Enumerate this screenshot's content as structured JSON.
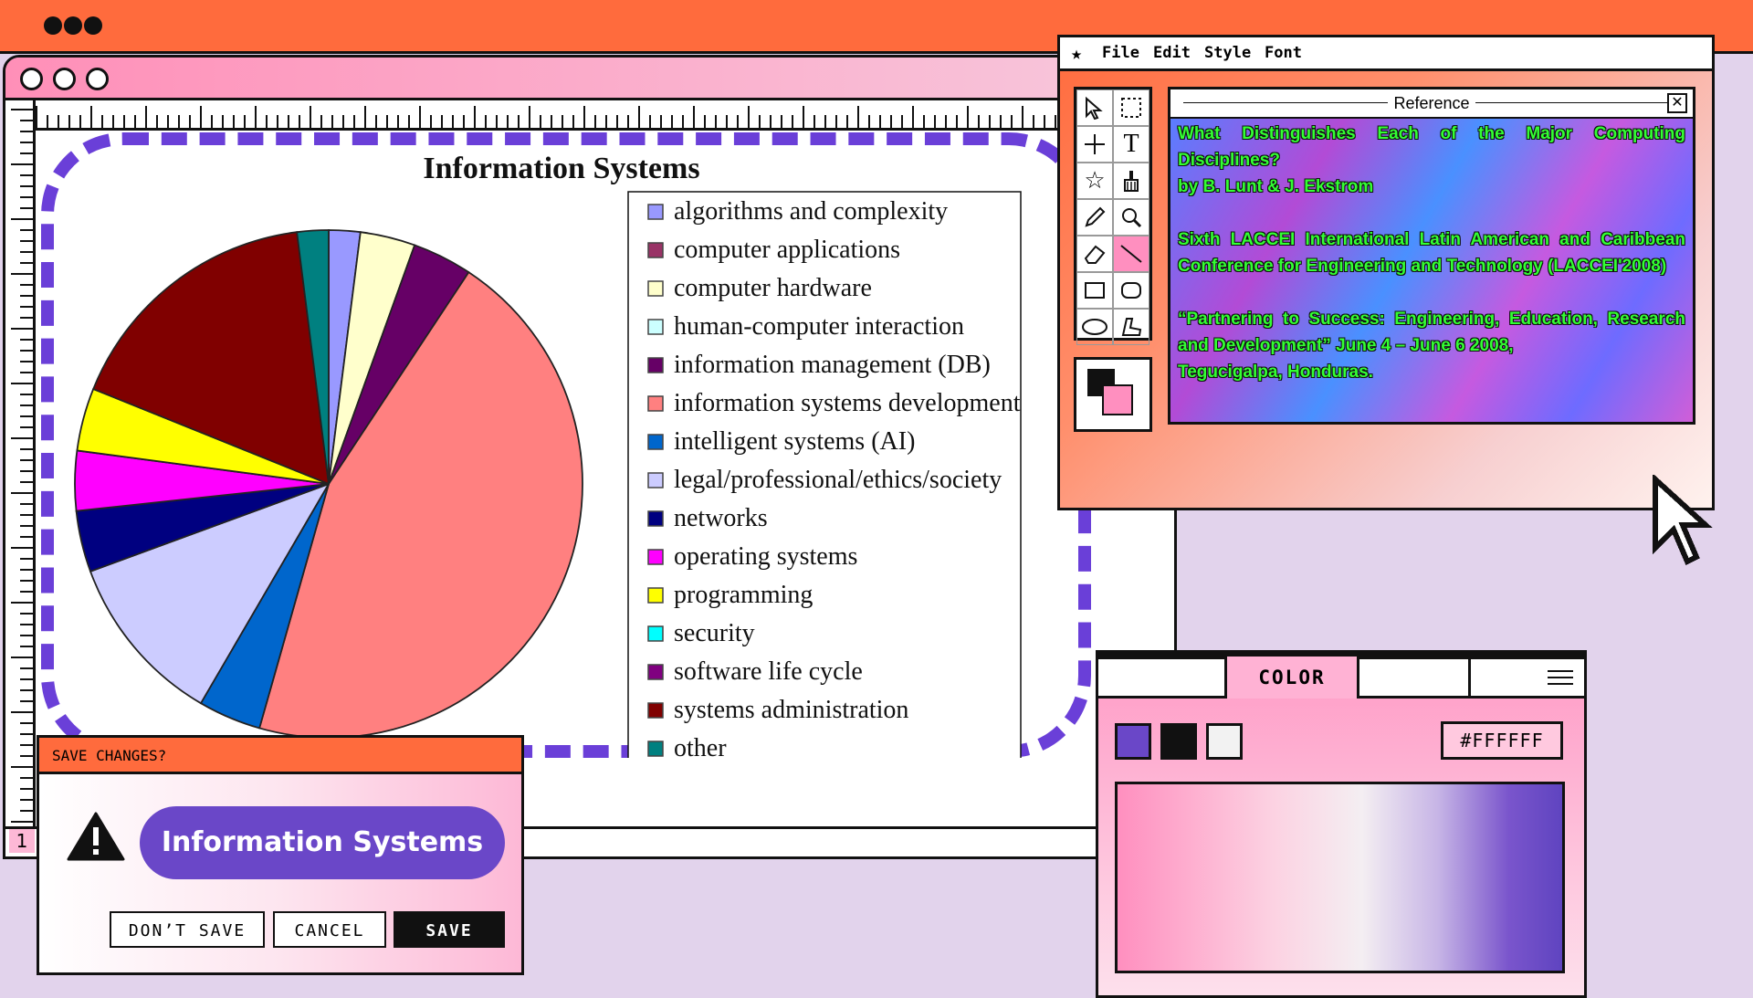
{
  "colors": {
    "accent_orange": "#ff6b3d",
    "accent_purple": "#6a47c8",
    "background": "#e2d3ec",
    "pink": "#fdb8d6"
  },
  "status_bar": {
    "page_number": "1"
  },
  "paint_window": {
    "menu": [
      "File",
      "Edit",
      "Style",
      "Font"
    ],
    "reference_panel": {
      "title": "Reference",
      "lines": [
        "What Distinguishes Each of the Major Computing Disciplines?",
        "by B. Lunt & J. Ekstrom",
        "Sixth LACCEI International Latin American and Caribbean Conference for Engineering and Technology (LACCEI'2008)",
        "“Partnering to Success: Engineering, Education, Research and Development” June 4 – June 6 2008,",
        "Tegucigalpa, Honduras."
      ]
    },
    "tools": [
      "arrow-tool",
      "marquee-tool",
      "crosshair-tool",
      "text-tool",
      "star-tool",
      "brush-tool",
      "pencil-tool",
      "zoom-tool",
      "eraser-tool",
      "line-tool",
      "rectangle-tool",
      "rounded-rect-tool",
      "ellipse-tool",
      "polygon-tool"
    ],
    "foreground_color": "#111111",
    "background_color": "#ff8fbf"
  },
  "save_dialog": {
    "title": "SAVE CHANGES?",
    "message": "Information Systems",
    "buttons": {
      "dont_save": "DON’T SAVE",
      "cancel": "CANCEL",
      "save": "SAVE"
    }
  },
  "color_panel": {
    "tab_label": "COLOR",
    "swatches": [
      "#6a47c8",
      "#111111",
      "#f2f2f2"
    ],
    "hex_value": "#FFFFFF",
    "gradient": [
      "#ff8fbf",
      "#f4eef2",
      "#5f44c0"
    ]
  },
  "chart_data": {
    "type": "pie",
    "title": "Information Systems",
    "legend_position": "right",
    "series": [
      {
        "name": "algorithms and complexity",
        "value": 2.0,
        "color": "#9999ff"
      },
      {
        "name": "computer applications",
        "value": 0.0,
        "color": "#993366"
      },
      {
        "name": "computer hardware",
        "value": 3.5,
        "color": "#ffffcc"
      },
      {
        "name": "human-computer interaction",
        "value": 0.0,
        "color": "#ccffff"
      },
      {
        "name": "information management (DB)",
        "value": 3.8,
        "color": "#660066"
      },
      {
        "name": "information systems development",
        "value": 45.1,
        "color": "#ff8080"
      },
      {
        "name": "intelligent systems (AI)",
        "value": 4.0,
        "color": "#0066cc"
      },
      {
        "name": "legal/professional/ethics/society",
        "value": 11.0,
        "color": "#ccccff"
      },
      {
        "name": "networks",
        "value": 3.9,
        "color": "#000080"
      },
      {
        "name": "operating systems",
        "value": 3.8,
        "color": "#ff00ff"
      },
      {
        "name": "programming",
        "value": 4.0,
        "color": "#ffff00"
      },
      {
        "name": "security",
        "value": 0.0,
        "color": "#00ffff"
      },
      {
        "name": "software life cycle",
        "value": 0.0,
        "color": "#800080"
      },
      {
        "name": "systems administration",
        "value": 16.9,
        "color": "#800000"
      },
      {
        "name": "other",
        "value": 2.0,
        "color": "#008080"
      }
    ]
  }
}
